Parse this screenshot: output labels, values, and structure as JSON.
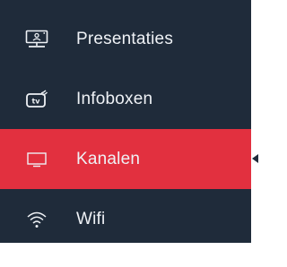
{
  "sidebar": {
    "items": [
      {
        "label": "Presentaties",
        "icon": "presentation-screen-icon",
        "active": false
      },
      {
        "label": "Infoboxen",
        "icon": "tv-icon",
        "active": false
      },
      {
        "label": "Kanalen",
        "icon": "monitor-icon",
        "active": true
      },
      {
        "label": "Wifi",
        "icon": "wifi-icon",
        "active": false
      }
    ]
  },
  "colors": {
    "sidebar_bg": "#1f2b3a",
    "active_bg": "#e2303f",
    "text": "#eef1f5",
    "page_bg": "#ffffff"
  }
}
